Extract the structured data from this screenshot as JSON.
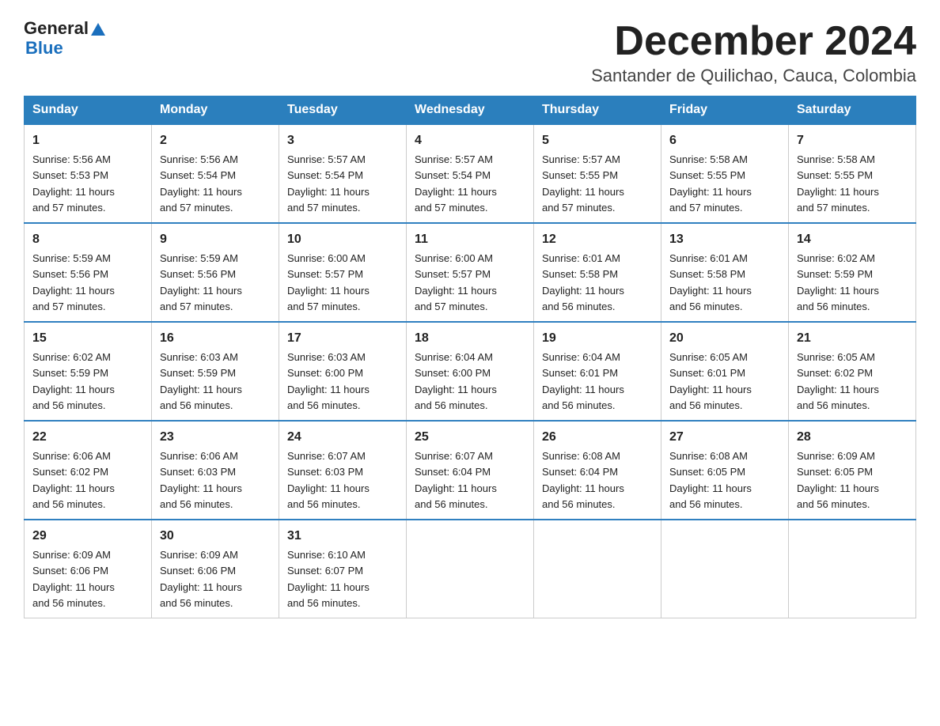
{
  "logo": {
    "general": "General",
    "blue": "Blue",
    "triangle": true
  },
  "header": {
    "title": "December 2024",
    "subtitle": "Santander de Quilichao, Cauca, Colombia"
  },
  "days_of_week": [
    "Sunday",
    "Monday",
    "Tuesday",
    "Wednesday",
    "Thursday",
    "Friday",
    "Saturday"
  ],
  "weeks": [
    [
      {
        "day": "1",
        "sunrise": "5:56 AM",
        "sunset": "5:53 PM",
        "daylight": "11 hours and 57 minutes."
      },
      {
        "day": "2",
        "sunrise": "5:56 AM",
        "sunset": "5:54 PM",
        "daylight": "11 hours and 57 minutes."
      },
      {
        "day": "3",
        "sunrise": "5:57 AM",
        "sunset": "5:54 PM",
        "daylight": "11 hours and 57 minutes."
      },
      {
        "day": "4",
        "sunrise": "5:57 AM",
        "sunset": "5:54 PM",
        "daylight": "11 hours and 57 minutes."
      },
      {
        "day": "5",
        "sunrise": "5:57 AM",
        "sunset": "5:55 PM",
        "daylight": "11 hours and 57 minutes."
      },
      {
        "day": "6",
        "sunrise": "5:58 AM",
        "sunset": "5:55 PM",
        "daylight": "11 hours and 57 minutes."
      },
      {
        "day": "7",
        "sunrise": "5:58 AM",
        "sunset": "5:55 PM",
        "daylight": "11 hours and 57 minutes."
      }
    ],
    [
      {
        "day": "8",
        "sunrise": "5:59 AM",
        "sunset": "5:56 PM",
        "daylight": "11 hours and 57 minutes."
      },
      {
        "day": "9",
        "sunrise": "5:59 AM",
        "sunset": "5:56 PM",
        "daylight": "11 hours and 57 minutes."
      },
      {
        "day": "10",
        "sunrise": "6:00 AM",
        "sunset": "5:57 PM",
        "daylight": "11 hours and 57 minutes."
      },
      {
        "day": "11",
        "sunrise": "6:00 AM",
        "sunset": "5:57 PM",
        "daylight": "11 hours and 57 minutes."
      },
      {
        "day": "12",
        "sunrise": "6:01 AM",
        "sunset": "5:58 PM",
        "daylight": "11 hours and 56 minutes."
      },
      {
        "day": "13",
        "sunrise": "6:01 AM",
        "sunset": "5:58 PM",
        "daylight": "11 hours and 56 minutes."
      },
      {
        "day": "14",
        "sunrise": "6:02 AM",
        "sunset": "5:59 PM",
        "daylight": "11 hours and 56 minutes."
      }
    ],
    [
      {
        "day": "15",
        "sunrise": "6:02 AM",
        "sunset": "5:59 PM",
        "daylight": "11 hours and 56 minutes."
      },
      {
        "day": "16",
        "sunrise": "6:03 AM",
        "sunset": "5:59 PM",
        "daylight": "11 hours and 56 minutes."
      },
      {
        "day": "17",
        "sunrise": "6:03 AM",
        "sunset": "6:00 PM",
        "daylight": "11 hours and 56 minutes."
      },
      {
        "day": "18",
        "sunrise": "6:04 AM",
        "sunset": "6:00 PM",
        "daylight": "11 hours and 56 minutes."
      },
      {
        "day": "19",
        "sunrise": "6:04 AM",
        "sunset": "6:01 PM",
        "daylight": "11 hours and 56 minutes."
      },
      {
        "day": "20",
        "sunrise": "6:05 AM",
        "sunset": "6:01 PM",
        "daylight": "11 hours and 56 minutes."
      },
      {
        "day": "21",
        "sunrise": "6:05 AM",
        "sunset": "6:02 PM",
        "daylight": "11 hours and 56 minutes."
      }
    ],
    [
      {
        "day": "22",
        "sunrise": "6:06 AM",
        "sunset": "6:02 PM",
        "daylight": "11 hours and 56 minutes."
      },
      {
        "day": "23",
        "sunrise": "6:06 AM",
        "sunset": "6:03 PM",
        "daylight": "11 hours and 56 minutes."
      },
      {
        "day": "24",
        "sunrise": "6:07 AM",
        "sunset": "6:03 PM",
        "daylight": "11 hours and 56 minutes."
      },
      {
        "day": "25",
        "sunrise": "6:07 AM",
        "sunset": "6:04 PM",
        "daylight": "11 hours and 56 minutes."
      },
      {
        "day": "26",
        "sunrise": "6:08 AM",
        "sunset": "6:04 PM",
        "daylight": "11 hours and 56 minutes."
      },
      {
        "day": "27",
        "sunrise": "6:08 AM",
        "sunset": "6:05 PM",
        "daylight": "11 hours and 56 minutes."
      },
      {
        "day": "28",
        "sunrise": "6:09 AM",
        "sunset": "6:05 PM",
        "daylight": "11 hours and 56 minutes."
      }
    ],
    [
      {
        "day": "29",
        "sunrise": "6:09 AM",
        "sunset": "6:06 PM",
        "daylight": "11 hours and 56 minutes."
      },
      {
        "day": "30",
        "sunrise": "6:09 AM",
        "sunset": "6:06 PM",
        "daylight": "11 hours and 56 minutes."
      },
      {
        "day": "31",
        "sunrise": "6:10 AM",
        "sunset": "6:07 PM",
        "daylight": "11 hours and 56 minutes."
      },
      null,
      null,
      null,
      null
    ]
  ],
  "labels": {
    "sunrise": "Sunrise:",
    "sunset": "Sunset:",
    "daylight": "Daylight:"
  }
}
